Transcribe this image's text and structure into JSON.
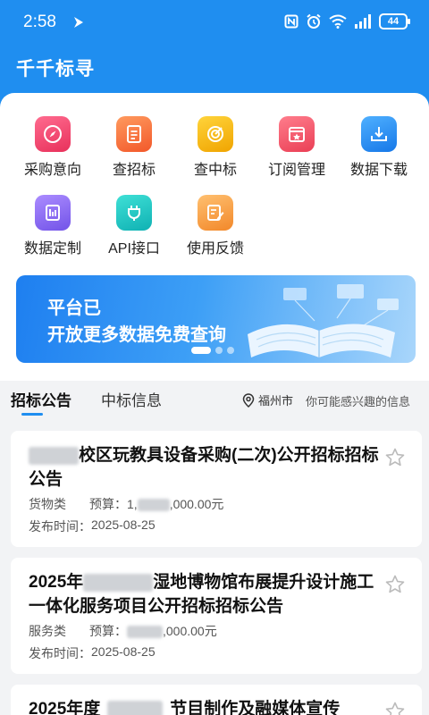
{
  "status_bar": {
    "time": "2:58",
    "battery": "44"
  },
  "app": {
    "title": "千千标寻"
  },
  "menu": {
    "items": [
      {
        "label": "采购意向",
        "icon": "compass-icon",
        "color": "#f0446e"
      },
      {
        "label": "查招标",
        "icon": "document-list-icon",
        "color": "#f86e3a"
      },
      {
        "label": "查中标",
        "icon": "target-icon",
        "color": "#f6b80e"
      },
      {
        "label": "订阅管理",
        "icon": "subscribe-calendar-icon",
        "color": "#f25a6a"
      },
      {
        "label": "数据下载",
        "icon": "download-icon",
        "color": "#1f8ef0"
      },
      {
        "label": "数据定制",
        "icon": "data-custom-icon",
        "color": "#8b6cf0"
      },
      {
        "label": "API接口",
        "icon": "plug-icon",
        "color": "#19c2c0"
      },
      {
        "label": "使用反馈",
        "icon": "feedback-edit-icon",
        "color": "#f8a43c"
      }
    ]
  },
  "banner": {
    "line1": "平台已",
    "line2": "开放更多数据免费查询"
  },
  "tabs": {
    "items": [
      {
        "label": "招标公告",
        "active": true
      },
      {
        "label": "中标信息",
        "active": false
      }
    ],
    "location": "福州市",
    "interest": "你可能感兴趣的信息"
  },
  "listings": [
    {
      "title_prefix_hidden": true,
      "title": "校区玩教具设备采购(二次)公开招标招标公告",
      "category": "货物类",
      "budget_label": "预算：",
      "budget_prefix": "1,",
      "budget_suffix": ",000.00元",
      "publish_label": "发布时间：",
      "publish_date": "2025-08-25"
    },
    {
      "title_prefix": "2025年",
      "title": "湿地博物馆布展提升设计施工一体化服务项目公开招标招标公告",
      "category": "服务类",
      "budget_label": "预算：",
      "budget_prefix": "",
      "budget_suffix": ",000.00元",
      "publish_label": "发布时间：",
      "publish_date": "2025-08-25"
    },
    {
      "title_prefix": "2025年度",
      "title": "节目制作及融媒体宣传"
    }
  ]
}
